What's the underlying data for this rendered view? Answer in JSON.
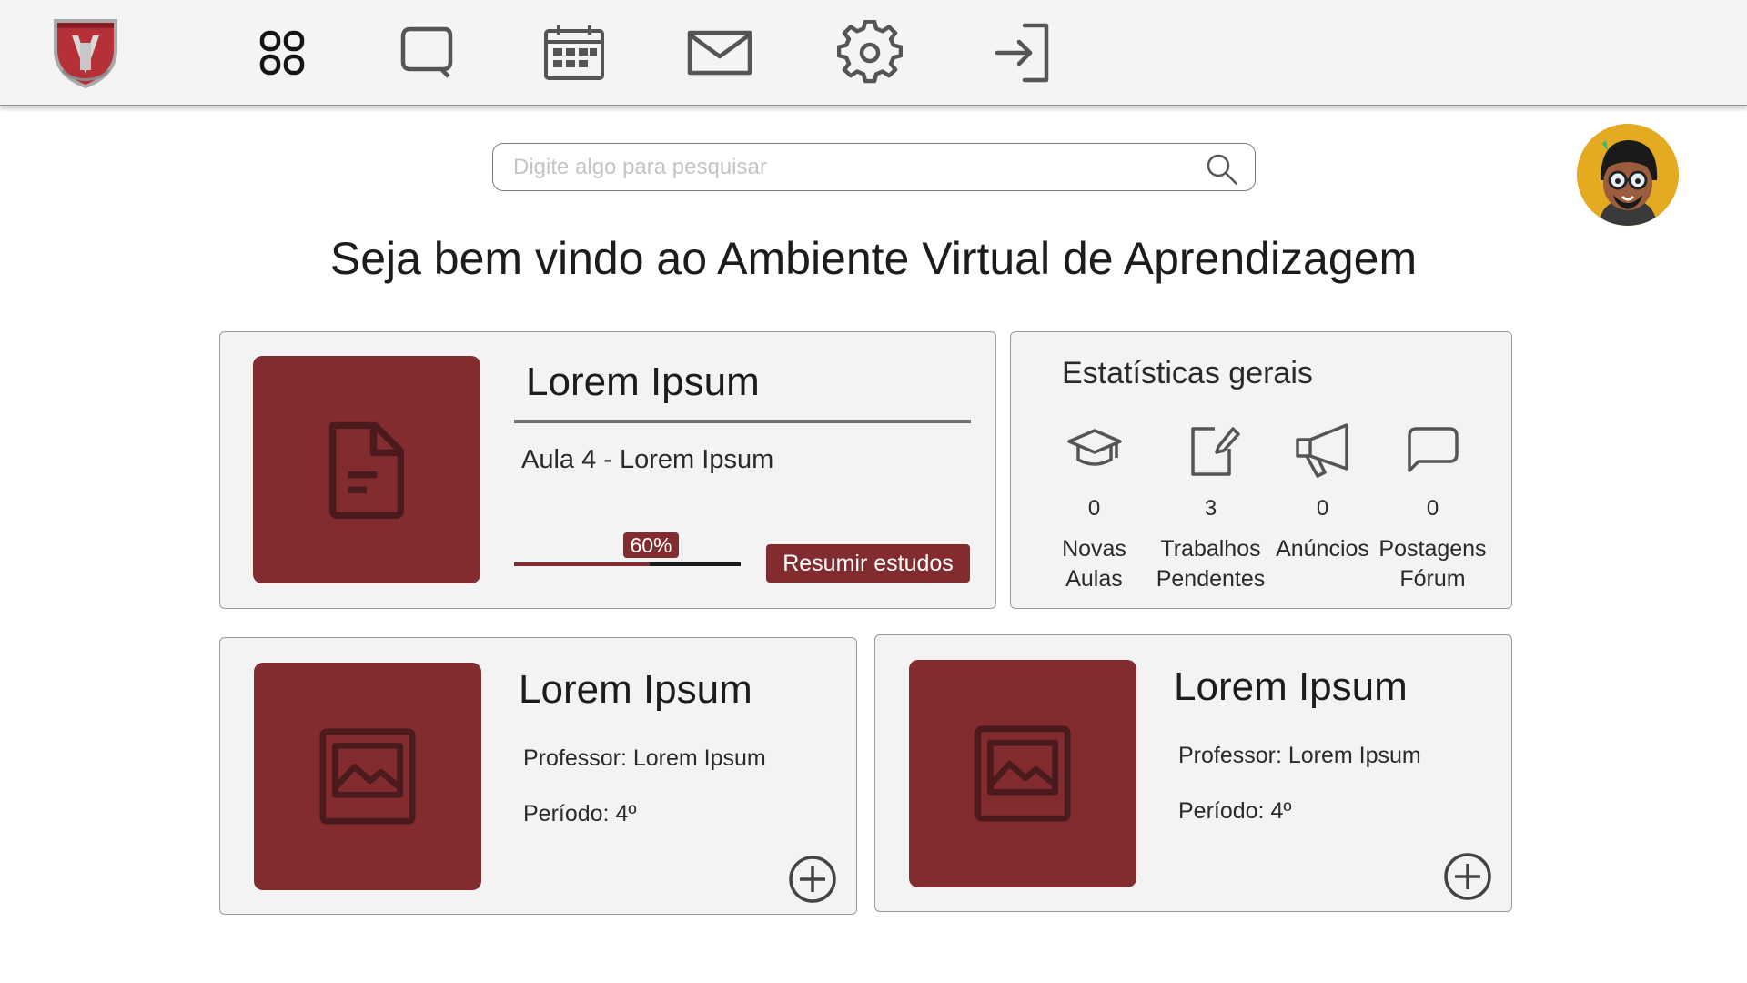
{
  "nav": {
    "items": [
      {
        "icon": "dashboard-icon"
      },
      {
        "icon": "chat-icon"
      },
      {
        "icon": "calendar-icon"
      },
      {
        "icon": "mail-icon"
      },
      {
        "icon": "settings-icon"
      },
      {
        "icon": "logout-icon"
      }
    ]
  },
  "search": {
    "placeholder": "Digite algo para pesquisar",
    "value": ""
  },
  "welcome": "Seja bem vindo ao Ambiente Virtual de Aprendizagem",
  "current_course": {
    "title": "Lorem Ipsum",
    "lesson": "Aula 4 - Lorem Ipsum",
    "progress": 0.6,
    "progress_label": "60%",
    "resume_label": "Resumir estudos"
  },
  "stats": {
    "title": "Estatísticas gerais",
    "items": [
      {
        "icon": "graduation-cap-icon",
        "value": "0",
        "label": "Novas\nAulas"
      },
      {
        "icon": "assignment-icon",
        "value": "3",
        "label": "Trabalhos\nPendentes"
      },
      {
        "icon": "megaphone-icon",
        "value": "0",
        "label": "Anúncios"
      },
      {
        "icon": "forum-icon",
        "value": "0",
        "label": "Postagens\nFórum"
      }
    ]
  },
  "courses": [
    {
      "title": "Lorem Ipsum",
      "professor": "Professor: Lorem Ipsum",
      "period": "Período: 4º"
    },
    {
      "title": "Lorem Ipsum",
      "professor": "Professor: Lorem Ipsum",
      "period": "Período: 4º"
    }
  ],
  "colors": {
    "accent": "#832c30",
    "card_bg": "#f3f3f3",
    "topbar_bg": "#f4f4f4"
  }
}
